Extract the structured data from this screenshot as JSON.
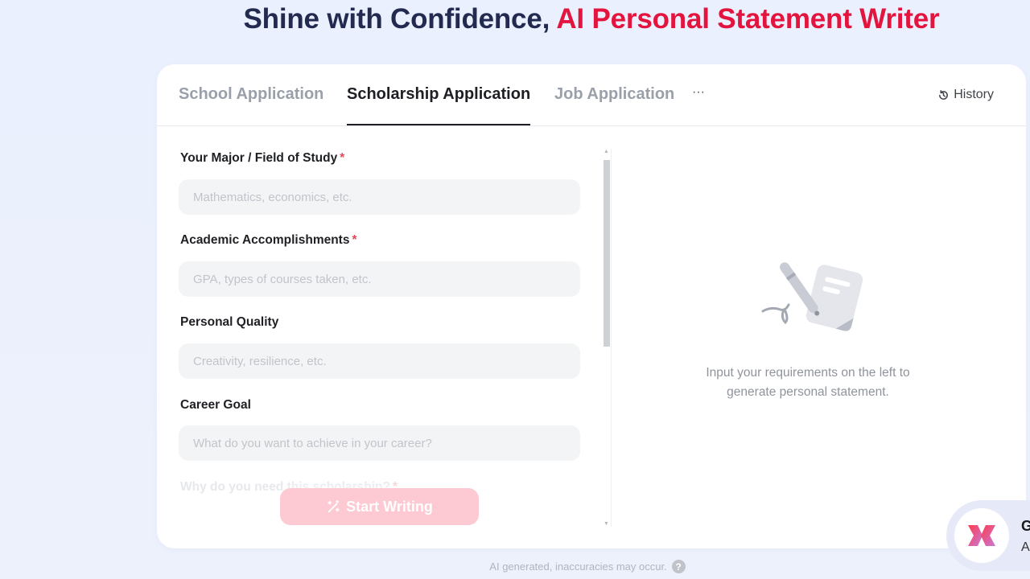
{
  "headline": {
    "part1": "Shine with Confidence,",
    "part2": "AI Personal Statement Writer"
  },
  "tabs": [
    {
      "label": "School Application",
      "active": false
    },
    {
      "label": "Scholarship Application",
      "active": true
    },
    {
      "label": "Job Application",
      "active": false
    }
  ],
  "tabs_more": "···",
  "history": {
    "label": "History",
    "icon": "history-icon"
  },
  "form": {
    "fields": [
      {
        "label": "Your Major / Field of Study",
        "required": true,
        "placeholder": "Mathematics, economics, etc.",
        "value": ""
      },
      {
        "label": "Academic Accomplishments",
        "required": true,
        "placeholder": "GPA, types of courses taken, etc.",
        "value": ""
      },
      {
        "label": "Personal Quality",
        "required": false,
        "placeholder": "Creativity, resilience, etc.",
        "value": ""
      },
      {
        "label": "Career Goal",
        "required": false,
        "placeholder": "What do you want to achieve in your career?",
        "value": ""
      },
      {
        "label": "Why do you need this scholarship?",
        "required": true,
        "placeholder": "",
        "value": ""
      }
    ],
    "required_mark": "*",
    "start_button": {
      "label": "Start Writing",
      "icon": "magic-wand-icon",
      "enabled": false
    },
    "scroll_position": 0
  },
  "empty_state": {
    "icon": "document-pen-icon",
    "line1": "Input your requirements on the left to",
    "line2": "generate personal statement."
  },
  "disclaimer": {
    "text": "AI generated, inaccuracies may occur.",
    "icon": "?"
  },
  "promo": {
    "title": "G",
    "subtitle": "A"
  },
  "colors": {
    "headline_dark": "#232a4f",
    "accent": "#e3143e",
    "button_disabled": "#fdcad3",
    "input_bg": "#f3f4f6"
  }
}
